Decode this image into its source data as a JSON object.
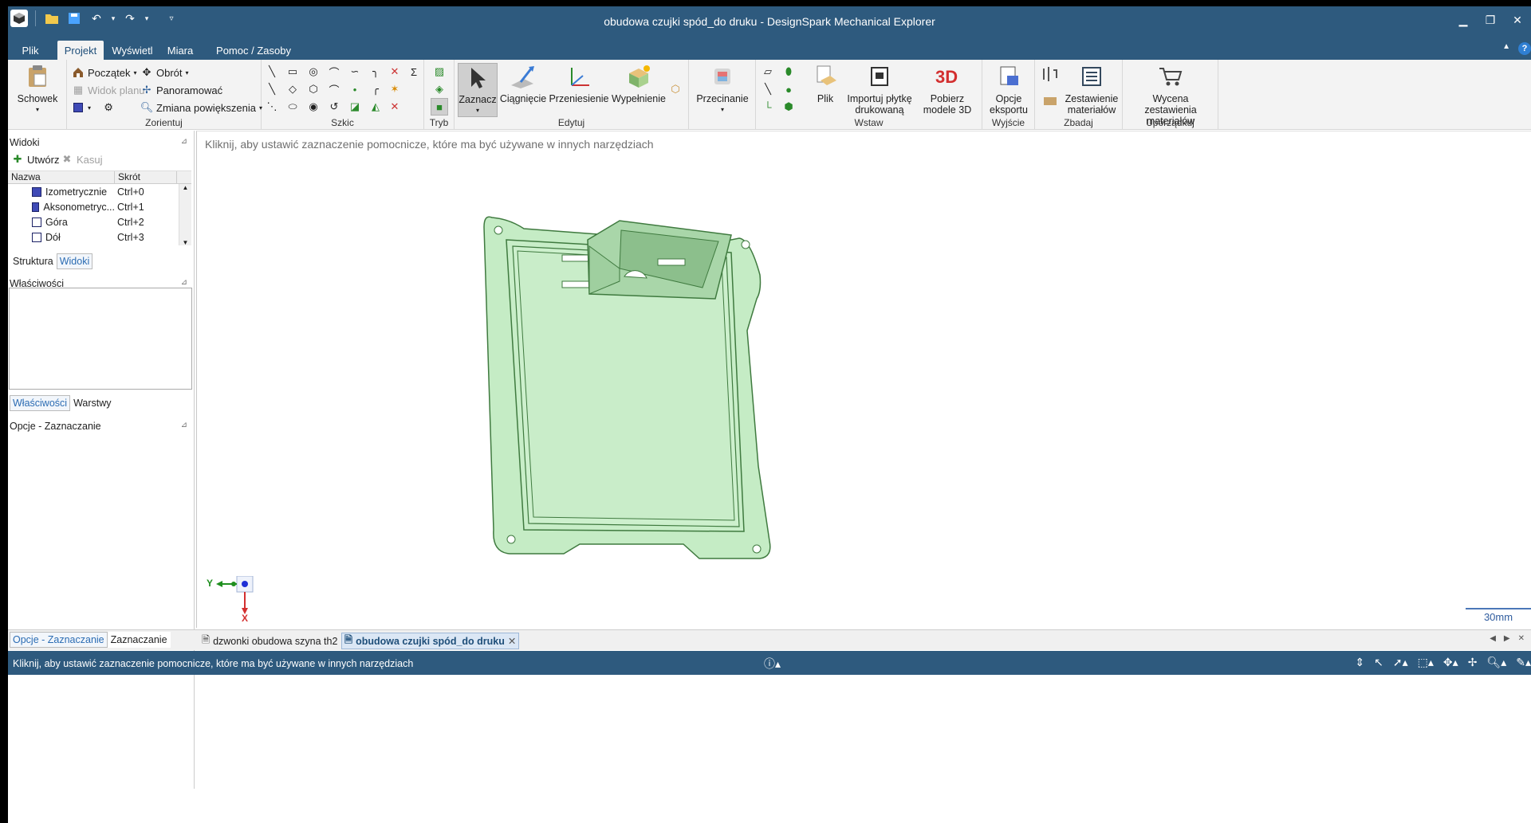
{
  "window": {
    "title": "obudowa czujki spód_do druku - DesignSpark Mechanical Explorer"
  },
  "ribbon_tabs": [
    "Plik",
    "Projekt",
    "Wyświetl",
    "Miara",
    "Pomoc / Zasoby"
  ],
  "ribbon": {
    "groups": {
      "schowek": "Schowek",
      "zorientuj": "Zorientuj",
      "szkic": "Szkic",
      "tryb": "Tryb",
      "edytuj": "Edytuj",
      "wstaw": "Wstaw",
      "wyjscie": "Wyjście",
      "zbadaj": "Zbadaj",
      "uporzadkuj": "Uporządkuj"
    },
    "orient": {
      "poczatek": "Początek",
      "obrot": "Obrót",
      "widok_planu": "Widok planu",
      "panoramowac": "Panoramować",
      "zmiana": "Zmiana powiększenia"
    },
    "buttons": {
      "zaznacz": "Zaznacz",
      "ciagniecie": "Ciągnięcie",
      "przeniesienie": "Przeniesienie",
      "wypelnienie": "Wypełnienie",
      "przecinanie": "Przecinanie",
      "plik": "Plik",
      "importuj": "Importuj płytkę drukowaną",
      "pobierz": "Pobierz modele 3D",
      "opcje_eksportu": "Opcje eksportu",
      "zestawienie": "Zestawienie materiałów",
      "wycena": "Wycena zestawienia materiałów"
    }
  },
  "left_panel": {
    "widoki_title": "Widoki",
    "utworz": "Utwórz",
    "kasuj": "Kasuj",
    "col_nazwa": "Nazwa",
    "col_skrot": "Skrót",
    "views": [
      {
        "name": "Izometrycznie",
        "shortcut": "Ctrl+0"
      },
      {
        "name": "Aksonometryc...",
        "shortcut": "Ctrl+1"
      },
      {
        "name": "Góra",
        "shortcut": "Ctrl+2"
      },
      {
        "name": "Dół",
        "shortcut": "Ctrl+3"
      }
    ],
    "tab_struktura": "Struktura",
    "tab_widoki": "Widoki",
    "wlasciwosci_title": "Właściwości",
    "tab_wlasciwosci": "Właściwości",
    "tab_warstwy": "Warstwy",
    "opcje_title": "Opcje - Zaznaczanie",
    "tab_opcje": "Opcje - Zaznaczanie",
    "tab_zaznaczanie": "Zaznaczanie"
  },
  "viewport": {
    "hint": "Kliknij, aby ustawić zaznaczenie pomocnicze, które ma być używane w innych narzędziach",
    "scale": "30mm",
    "axis_y": "Y",
    "axis_x": "X",
    "model_color": "#c5ecc5"
  },
  "doc_tabs": [
    {
      "name": "dzwonki obudowa szyna th2"
    },
    {
      "name": "obudowa czujki spód_do druku"
    }
  ],
  "status": {
    "message": "Kliknij, aby ustawić zaznaczenie pomocnicze, które ma być używane w innych narzędziach"
  }
}
